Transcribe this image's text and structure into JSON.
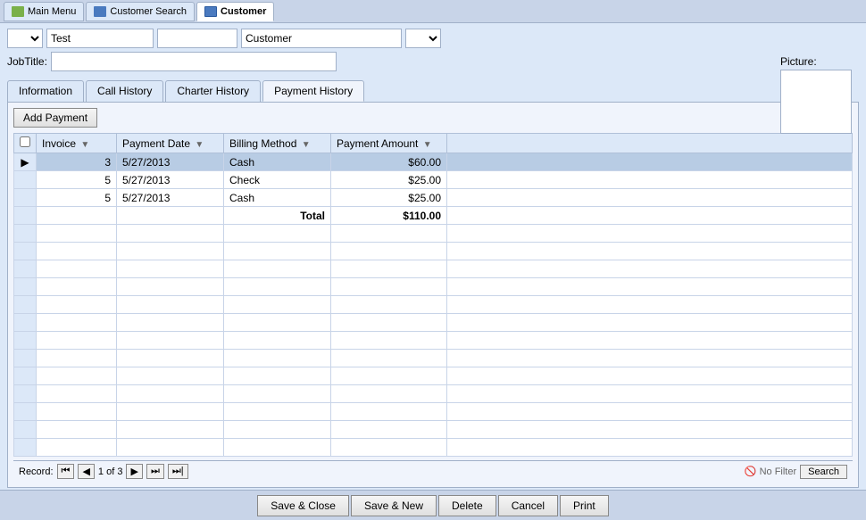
{
  "tabBar": {
    "items": [
      {
        "id": "main-menu",
        "label": "Main Menu",
        "iconType": "home",
        "active": false
      },
      {
        "id": "customer-search",
        "label": "Customer Search",
        "iconType": "search",
        "active": false
      },
      {
        "id": "customer",
        "label": "Customer",
        "iconType": "customer",
        "active": true
      }
    ]
  },
  "form": {
    "firstNameDropdown": "",
    "firstName": "Test",
    "middleName": "",
    "lastName": "Customer",
    "suffixDropdown": "",
    "jobTitleLabel": "JobTitle:",
    "jobTitle": "",
    "pictureLabel": "Picture:"
  },
  "tabs": [
    {
      "id": "information",
      "label": "Information",
      "active": false
    },
    {
      "id": "call-history",
      "label": "Call History",
      "active": false
    },
    {
      "id": "charter-history",
      "label": "Charter History",
      "active": false
    },
    {
      "id": "payment-history",
      "label": "Payment History",
      "active": true
    }
  ],
  "paymentHistory": {
    "addButtonLabel": "Add Payment",
    "columns": [
      {
        "id": "invoice",
        "label": "Invoice",
        "sortable": true
      },
      {
        "id": "payment-date",
        "label": "Payment Date",
        "sortable": true
      },
      {
        "id": "billing-method",
        "label": "Billing Method",
        "sortable": true
      },
      {
        "id": "payment-amount",
        "label": "Payment Amount",
        "sortable": true
      }
    ],
    "rows": [
      {
        "invoice": "3",
        "paymentDate": "5/27/2013",
        "billingMethod": "Cash",
        "paymentAmount": "$60.00",
        "selected": true
      },
      {
        "invoice": "5",
        "paymentDate": "5/27/2013",
        "billingMethod": "Check",
        "paymentAmount": "$25.00",
        "selected": false
      },
      {
        "invoice": "5",
        "paymentDate": "5/27/2013",
        "billingMethod": "Cash",
        "paymentAmount": "$25.00",
        "selected": false
      }
    ],
    "total": {
      "label": "Total",
      "amount": "$110.00"
    }
  },
  "navigation": {
    "recordLabel": "Record:",
    "firstLabel": "⏮",
    "prevLabel": "◀",
    "currentRecord": "1",
    "ofLabel": "of",
    "totalRecords": "3",
    "nextLabel": "▶",
    "lastLabel": "⏭",
    "newLabel": "⏭|",
    "noFilterLabel": "No Filter",
    "searchLabel": "Search"
  },
  "bottomBar": {
    "saveCloseLabel": "Save & Close",
    "saveNewLabel": "Save & New",
    "deleteLabel": "Delete",
    "cancelLabel": "Cancel",
    "printLabel": "Print"
  }
}
